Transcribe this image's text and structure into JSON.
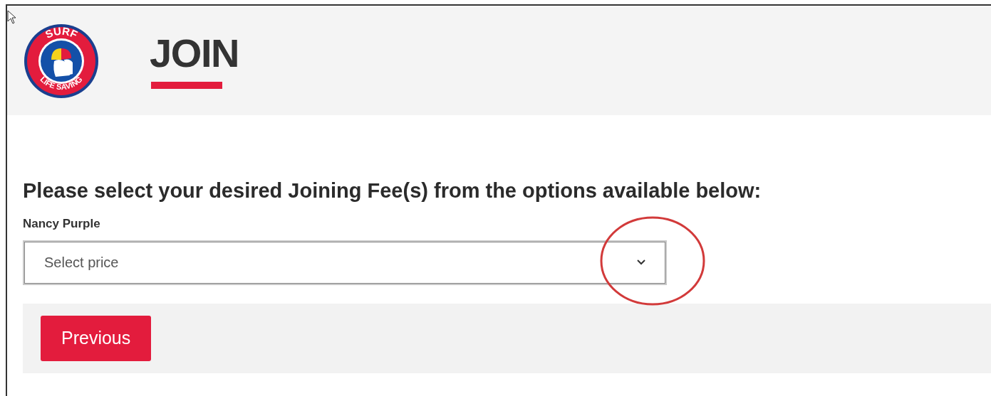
{
  "logo": {
    "top_text": "SURF",
    "bottom_text": "LIFE SAVING"
  },
  "header": {
    "title": "JOIN"
  },
  "form": {
    "heading": "Please select your desired Joining Fee(s) from the options available below:",
    "label": "Nancy Purple",
    "select": {
      "placeholder": "Select price",
      "highlighted": true
    }
  },
  "buttons": [
    {
      "label": "Previous"
    }
  ]
}
